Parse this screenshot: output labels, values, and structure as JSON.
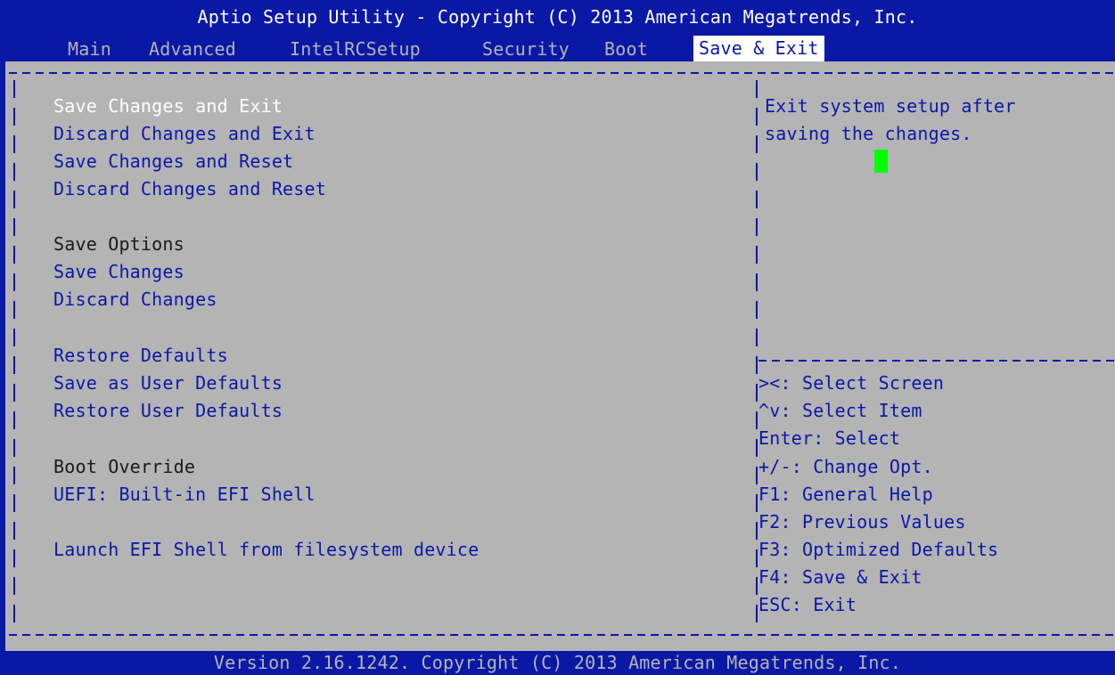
{
  "title": "Aptio Setup Utility - Copyright (C) 2013 American Megatrends, Inc.",
  "tabs": [
    {
      "label": "Main"
    },
    {
      "label": "Advanced"
    },
    {
      "label": "IntelRCSetup"
    },
    {
      "label": "Security"
    },
    {
      "label": "Boot"
    },
    {
      "label": "Save & Exit",
      "active": true
    }
  ],
  "menu": {
    "save_changes_and_exit": "Save Changes and Exit",
    "discard_changes_and_exit": "Discard Changes and Exit",
    "save_changes_and_reset": "Save Changes and Reset",
    "discard_changes_and_reset": "Discard Changes and Reset",
    "save_options_header": "Save Options",
    "save_changes": "Save Changes",
    "discard_changes": "Discard Changes",
    "restore_defaults": "Restore Defaults",
    "save_as_user_defaults": "Save as User Defaults",
    "restore_user_defaults": "Restore User Defaults",
    "boot_override_header": "Boot Override",
    "uefi_builtin_efi_shell": "UEFI: Built-in EFI Shell",
    "launch_efi_shell": "Launch EFI Shell from filesystem device"
  },
  "help": {
    "line1": "Exit system setup after",
    "line2": "saving the changes."
  },
  "keys": [
    "><: Select Screen",
    "^v: Select Item",
    "Enter: Select",
    "+/-: Change Opt.",
    "F1: General Help",
    "F2: Previous Values",
    "F3: Optimized Defaults",
    "F4: Save & Exit",
    "ESC: Exit"
  ],
  "footer": "Version 2.16.1242. Copyright (C) 2013 American Megatrends, Inc.",
  "colors": {
    "blue": "#0a18a6",
    "gray": "#b4b4b4",
    "white": "#ffffff",
    "cursor_green": "#00ff00"
  }
}
